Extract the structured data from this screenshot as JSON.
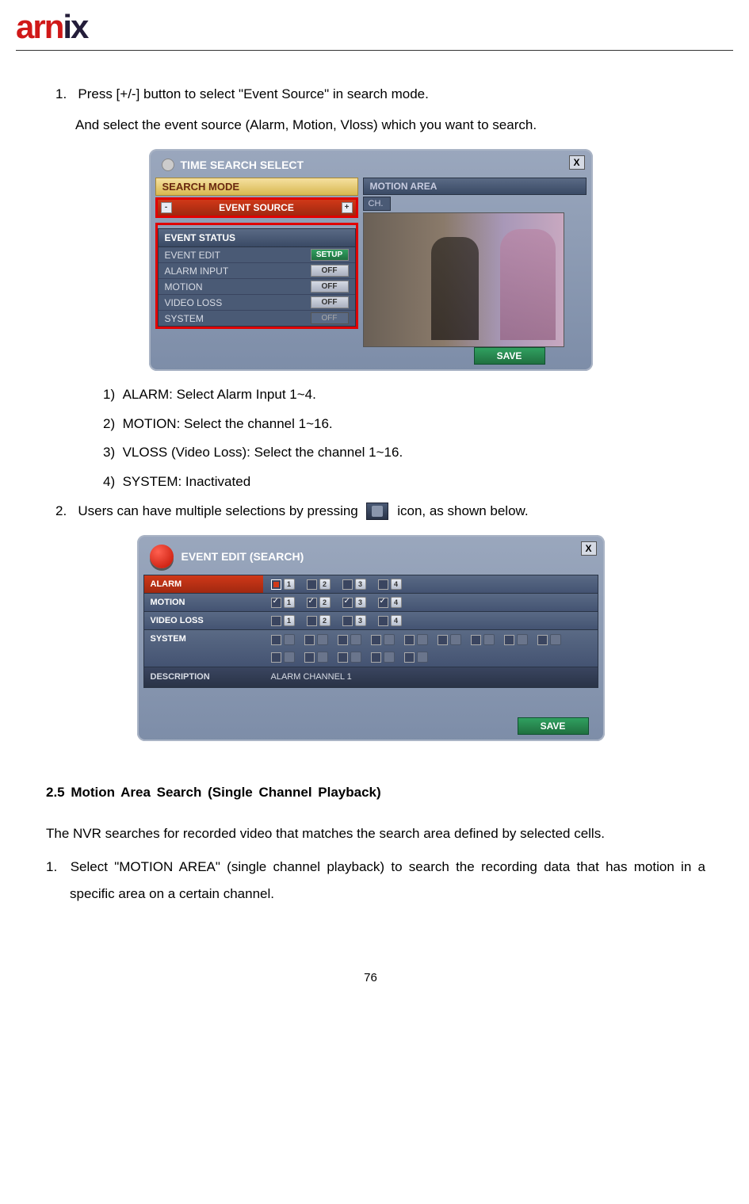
{
  "logo": {
    "part1": "arn",
    "part2": "ix"
  },
  "step1": {
    "num": "1.",
    "line1": "Press [+/-] button to select \"Event Source\" in search mode.",
    "line2": "And select the event source (Alarm, Motion, Vloss) which you want to search."
  },
  "shot1": {
    "title": "TIME SEARCH SELECT",
    "close": "X",
    "search_mode_label": "SEARCH MODE",
    "event_source": "EVENT SOURCE",
    "minus": "-",
    "plus": "+",
    "motion_area_label": "MOTION AREA",
    "ch_label": "CH.",
    "event_status_title": "EVENT STATUS",
    "rows": [
      {
        "label": "EVENT EDIT",
        "value": "SETUP",
        "cls": "val-setup"
      },
      {
        "label": "ALARM INPUT",
        "value": "OFF",
        "cls": "val-off"
      },
      {
        "label": "MOTION",
        "value": "OFF",
        "cls": "val-off"
      },
      {
        "label": "VIDEO LOSS",
        "value": "OFF",
        "cls": "val-off"
      },
      {
        "label": "SYSTEM",
        "value": "OFF",
        "cls": "val-off-dim"
      }
    ],
    "save": "SAVE"
  },
  "sublist": [
    {
      "num": "1)",
      "text": "ALARM: Select Alarm Input 1~4."
    },
    {
      "num": "2)",
      "text": "MOTION: Select the channel 1~16."
    },
    {
      "num": "3)",
      "text": "VLOSS (Video Loss): Select the channel 1~16."
    },
    {
      "num": "4)",
      "text": "SYSTEM: Inactivated"
    }
  ],
  "step2": {
    "num": "2.",
    "text_before": "Users can have multiple selections by pressing",
    "text_after": "icon, as shown below."
  },
  "shot2": {
    "title": "EVENT EDIT (SEARCH)",
    "close": "X",
    "rows": {
      "alarm": {
        "label": "ALARM",
        "nums": [
          "1",
          "2",
          "3",
          "4"
        ]
      },
      "motion": {
        "label": "MOTION",
        "nums": [
          "1",
          "2",
          "3",
          "4"
        ]
      },
      "vloss": {
        "label": "VIDEO LOSS",
        "nums": [
          "1",
          "2",
          "3",
          "4"
        ]
      },
      "system": {
        "label": "SYSTEM"
      }
    },
    "description_label": "DESCRIPTION",
    "description_value": "ALARM CHANNEL 1",
    "save": "SAVE"
  },
  "section_heading": "2.5  Motion  Area  Search  (Single  Channel  Playback)",
  "body_para": "The NVR searches for recorded video that matches the search area defined by selected cells.",
  "body_step1": {
    "num": "1.",
    "text": "Select \"MOTION AREA\" (single channel playback) to search the recording data that has motion in a specific area on a certain channel."
  },
  "page_number": "76"
}
